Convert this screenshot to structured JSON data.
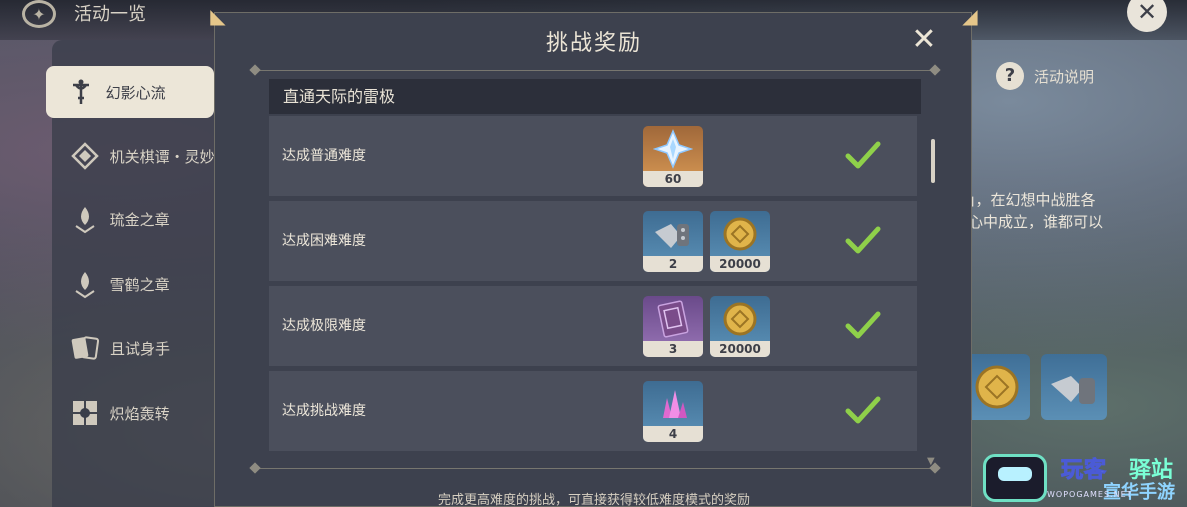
{
  "app": {
    "title": "活动一览",
    "logo_icon": "wind-compass-icon",
    "close_icon": "close-icon"
  },
  "sidebar": {
    "items": [
      {
        "label": "幻影心流",
        "icon": "sword-figure-icon",
        "active": true
      },
      {
        "label": "机关棋谭・灵妙",
        "icon": "diamond-grid-icon",
        "active": false
      },
      {
        "label": "琉金之章",
        "icon": "bulb-drop-icon",
        "active": false
      },
      {
        "label": "雪鹤之章",
        "icon": "bulb-drop-icon",
        "active": false
      },
      {
        "label": "且试身手",
        "icon": "cards-icon",
        "active": false
      },
      {
        "label": "炽焰轰转",
        "icon": "four-petal-icon",
        "active": false
      }
    ]
  },
  "background_panel": {
    "help_label": "活动说明",
    "description_lines": [
      "」，在幻想中战胜各",
      "心中成立，谁都可以"
    ]
  },
  "modal": {
    "title": "挑战奖励",
    "section_title": "直通天际的雷极",
    "rows": [
      {
        "label": "达成普通难度",
        "completed": true,
        "rewards": [
          {
            "icon": "primogem-icon",
            "count": "60",
            "color": "orange"
          }
        ]
      },
      {
        "label": "达成困难难度",
        "completed": true,
        "rewards": [
          {
            "icon": "talent-material-icon",
            "count": "2",
            "color": "blue"
          },
          {
            "icon": "mora-coin-icon",
            "count": "20000",
            "color": "blue"
          }
        ]
      },
      {
        "label": "达成极限难度",
        "completed": true,
        "rewards": [
          {
            "icon": "hero-wit-book-icon",
            "count": "3",
            "color": "purple"
          },
          {
            "icon": "mora-coin-icon",
            "count": "20000",
            "color": "blue"
          }
        ]
      },
      {
        "label": "达成挑战难度",
        "completed": true,
        "rewards": [
          {
            "icon": "crystal-ore-icon",
            "count": "4",
            "color": "blue"
          }
        ]
      }
    ],
    "footer": "完成更高难度的挑战，可直接获得较低难度模式的奖励"
  },
  "watermark": {
    "text_1": "玩客",
    "text_2": "驿站",
    "text_3": "宣华手游网",
    "text_4": "WOPOGAMES.NET"
  },
  "colors": {
    "check": "#8fd04a",
    "modal_bg": "#3d414e",
    "row_bg": "#4b4f5c",
    "header_bg": "#2c2f3a",
    "accent_gold": "#e5c68a"
  }
}
